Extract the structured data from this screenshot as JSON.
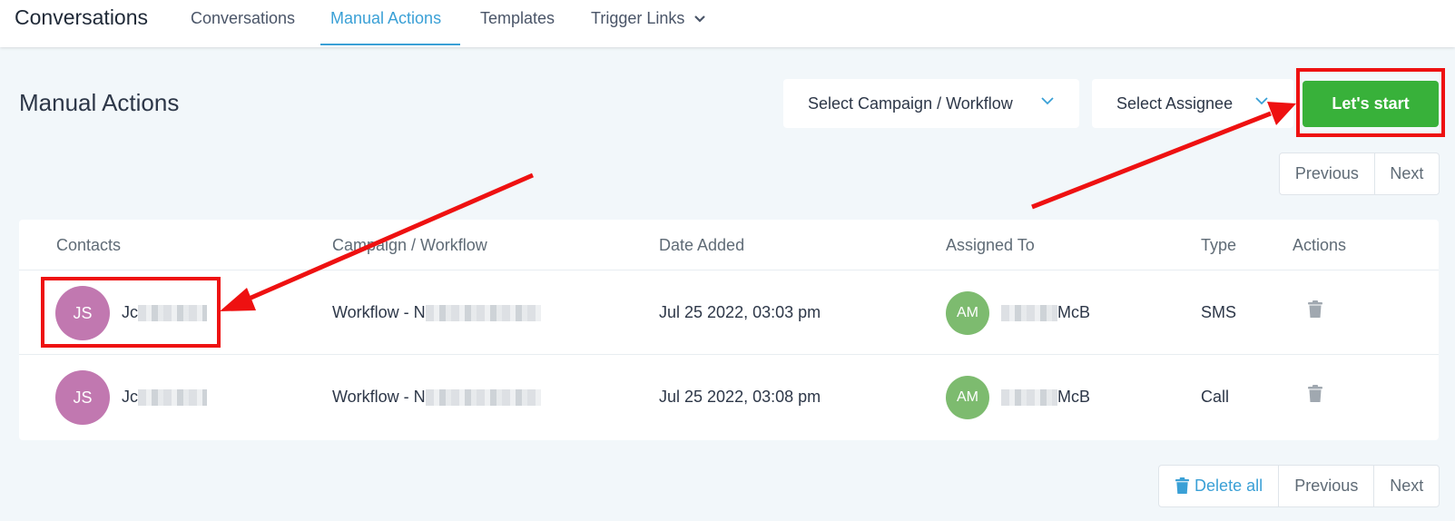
{
  "header": {
    "app_title": "Conversations",
    "tabs": [
      {
        "label": "Conversations",
        "active": false
      },
      {
        "label": "Manual Actions",
        "active": true
      },
      {
        "label": "Templates",
        "active": false
      },
      {
        "label": "Trigger Links",
        "active": false,
        "has_dropdown": true
      }
    ]
  },
  "toolbar": {
    "page_title": "Manual Actions",
    "campaign_select": "Select Campaign / Workflow",
    "assignee_select": "Select Assignee",
    "start_label": "Let's start"
  },
  "pagination_top": {
    "previous": "Previous",
    "next": "Next"
  },
  "table": {
    "columns": [
      "Contacts",
      "Campaign / Workflow",
      "Date Added",
      "Assigned To",
      "Type",
      "Actions"
    ],
    "rows": [
      {
        "contact_initials": "JS",
        "contact_name": "Jc",
        "workflow": "Workflow - N",
        "date_added": "Jul 25 2022, 03:03 pm",
        "assignee_initials": "AM",
        "assignee_name": "McB",
        "type": "SMS"
      },
      {
        "contact_initials": "JS",
        "contact_name": "Jc",
        "workflow": "Workflow - N",
        "date_added": "Jul 25 2022, 03:08 pm",
        "assignee_initials": "AM",
        "assignee_name": "McB",
        "type": "Call"
      }
    ]
  },
  "pagination_bottom": {
    "delete_all": "Delete all",
    "previous": "Previous",
    "next": "Next"
  },
  "colors": {
    "accent": "#3aa0d6",
    "start_button": "#38b13a",
    "contact_avatar": "#c178b0",
    "assignee_avatar": "#7dbb6f",
    "highlight": "#ee1111"
  }
}
